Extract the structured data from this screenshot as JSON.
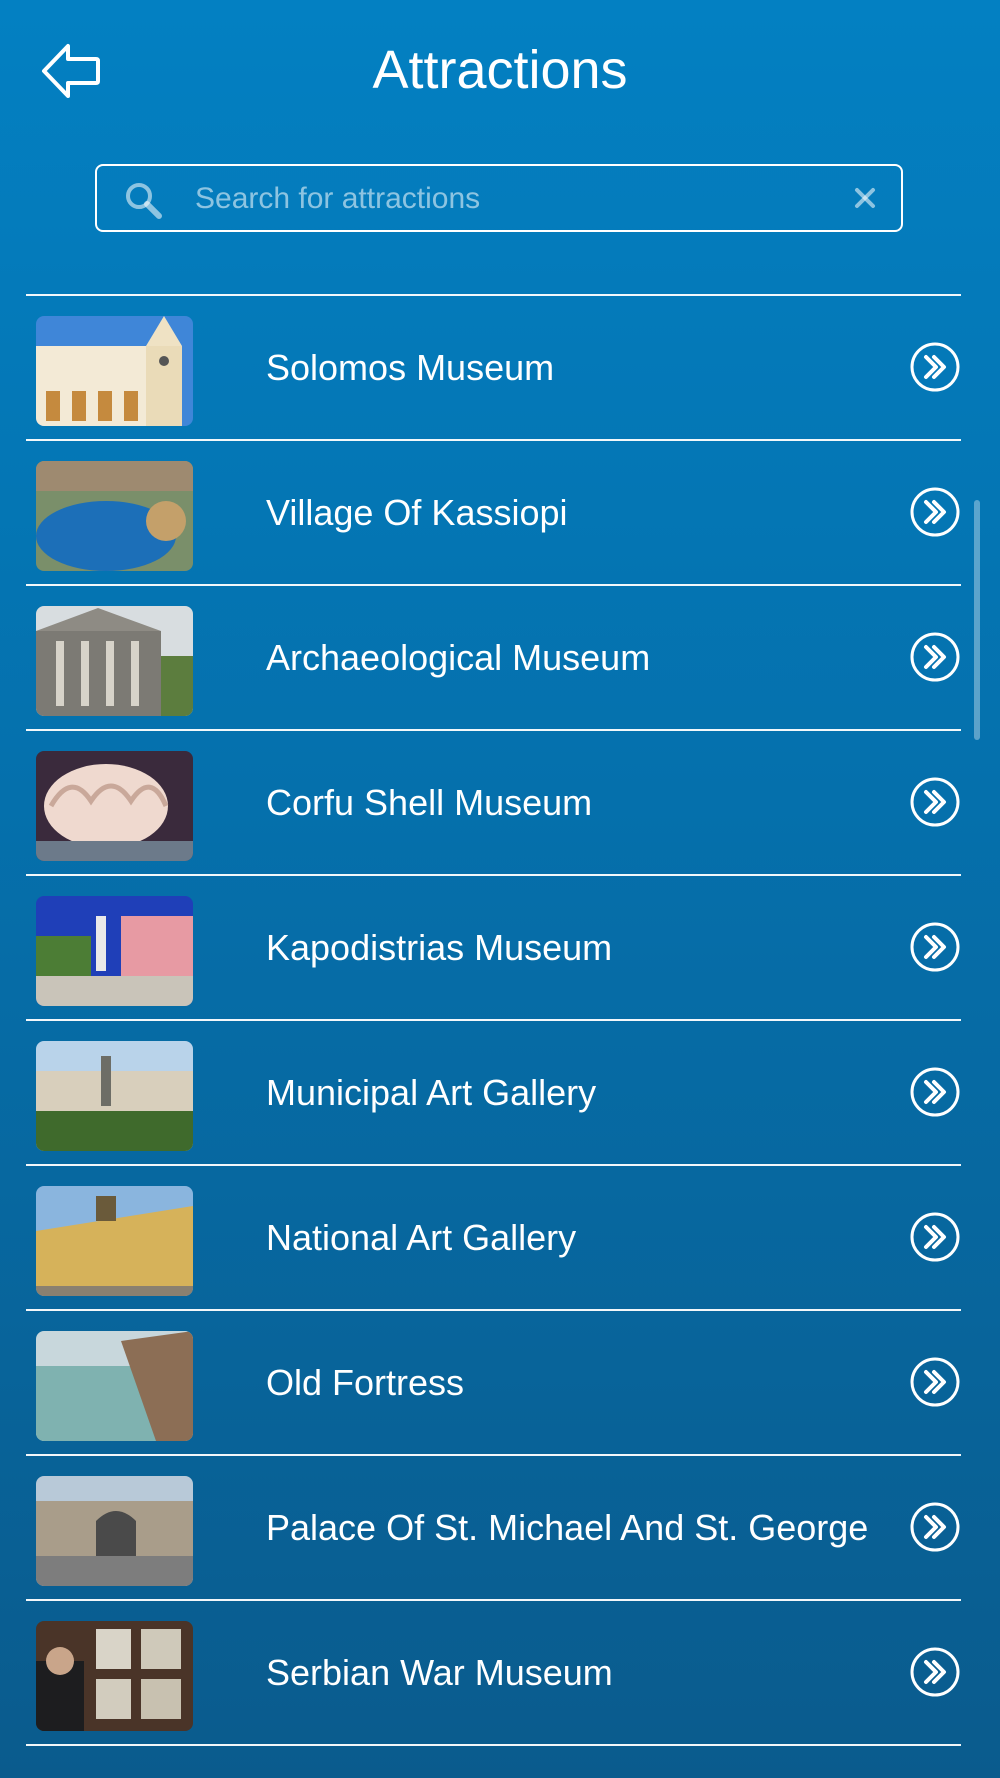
{
  "header": {
    "title": "Attractions",
    "back_icon": "back-arrow-icon"
  },
  "search": {
    "placeholder": "Search for attractions",
    "value": "",
    "search_icon": "search-icon",
    "clear_icon": "close-icon"
  },
  "attractions": [
    {
      "label": "Solomos Museum",
      "icon": "chevron-right-circle-icon"
    },
    {
      "label": "Village Of Kassiopi",
      "icon": "chevron-right-circle-icon"
    },
    {
      "label": "Archaeological Museum",
      "icon": "chevron-right-circle-icon"
    },
    {
      "label": "Corfu Shell Museum",
      "icon": "chevron-right-circle-icon"
    },
    {
      "label": "Kapodistrias Museum",
      "icon": "chevron-right-circle-icon"
    },
    {
      "label": "Municipal Art Gallery",
      "icon": "chevron-right-circle-icon"
    },
    {
      "label": "National Art Gallery",
      "icon": "chevron-right-circle-icon"
    },
    {
      "label": "Old Fortress",
      "icon": "chevron-right-circle-icon"
    },
    {
      "label": "Palace Of St. Michael And St. George",
      "icon": "chevron-right-circle-icon"
    },
    {
      "label": "Serbian War Museum",
      "icon": "chevron-right-circle-icon"
    }
  ],
  "colors": {
    "background_top": "#0380c2",
    "background_bottom": "#0a5b8d",
    "foreground": "#ffffff"
  }
}
